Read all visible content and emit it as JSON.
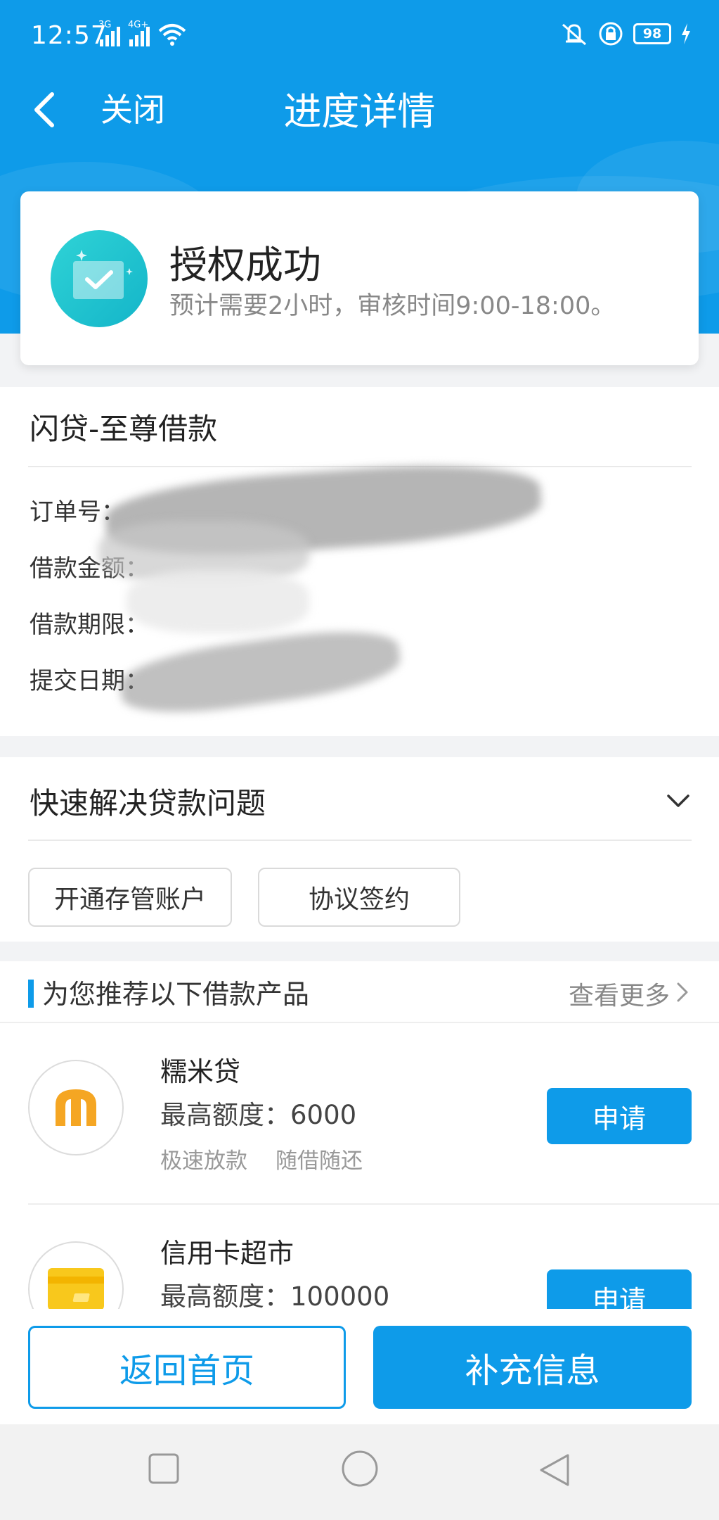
{
  "status_bar": {
    "time": "12:57",
    "network_1": "3G",
    "network_2": "4G+",
    "battery": "98",
    "icons": [
      "signal-icon",
      "wifi-icon",
      "vibrate-icon",
      "lock-rotation-icon",
      "battery-icon",
      "charging-icon"
    ]
  },
  "nav": {
    "back_icon": "chevron-left-icon",
    "close_label": "关闭",
    "title": "进度详情"
  },
  "auth_card": {
    "icon": "verified-envelope-icon",
    "title": "授权成功",
    "subtitle": "预计需要2小时，审核时间9:00-18:00。"
  },
  "order": {
    "title": "闪贷-至尊借款",
    "rows": [
      {
        "label": "订单号："
      },
      {
        "label": "借款金额："
      },
      {
        "label": "借款期限："
      },
      {
        "label": "提交日期："
      }
    ]
  },
  "quick": {
    "title": "快速解决贷款问题",
    "chevron_icon": "chevron-down-icon",
    "buttons": [
      "开通存管账户",
      "协议签约"
    ]
  },
  "recommend": {
    "heading": "为您推荐以下借款产品",
    "more_label": "查看更多",
    "products": [
      {
        "name": "糯米贷",
        "limit": "最高额度：6000",
        "tags": [
          "极速放款",
          "随借随还"
        ],
        "apply": "申请",
        "logo": "nuomidai-logo-icon",
        "logo_color": "#f5a623"
      },
      {
        "name": "信用卡超市",
        "limit": "最高额度：100000",
        "tags": [],
        "apply": "申请",
        "logo": "credit-card-icon",
        "logo_color": "#f8c81c"
      }
    ]
  },
  "bottom": {
    "home_label": "返回首页",
    "supplement_label": "补充信息"
  },
  "system_nav": {
    "icons": [
      "recent-apps-icon",
      "home-icon",
      "back-icon"
    ]
  },
  "colors": {
    "primary": "#0e9be9",
    "page_bg": "#f2f3f5",
    "text_muted": "#888888"
  }
}
